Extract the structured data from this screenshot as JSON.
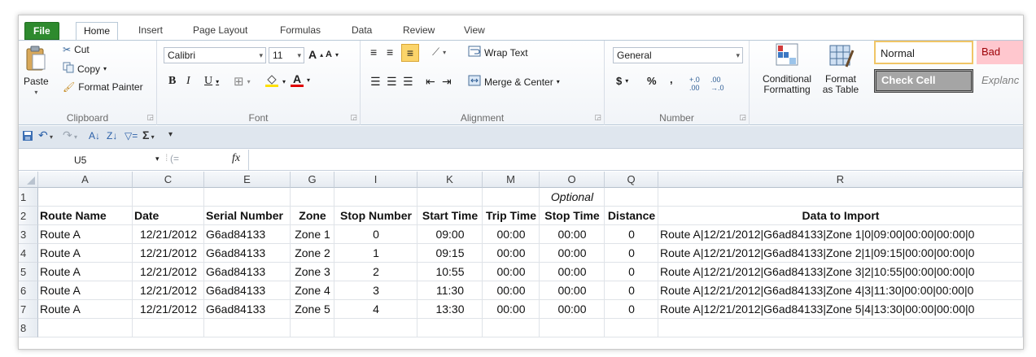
{
  "ribbon": {
    "tabs": [
      "File",
      "Home",
      "Insert",
      "Page Layout",
      "Formulas",
      "Data",
      "Review",
      "View"
    ],
    "clipboard": {
      "paste": "Paste",
      "cut": "Cut",
      "copy": "Copy",
      "format_painter": "Format Painter",
      "label": "Clipboard"
    },
    "font": {
      "name": "Calibri",
      "size": "11",
      "bold": "B",
      "italic": "I",
      "underline": "U",
      "grow": "A",
      "shrink": "A",
      "color_a": "A",
      "label": "Font"
    },
    "alignment": {
      "wrap_text": "Wrap Text",
      "merge_center": "Merge & Center",
      "label": "Alignment"
    },
    "number": {
      "format": "General",
      "currency": "$",
      "percent": "%",
      "comma": ",",
      "inc_dec": ".0 .00",
      "label": "Number"
    },
    "styles": {
      "conditional": "Conditional Formatting",
      "format_table": "Format as Table",
      "normal": "Normal",
      "bad": "Bad",
      "check_cell": "Check Cell",
      "explanatory": "Explanc"
    }
  },
  "formula_bar": {
    "name_box": "U5",
    "fx": "fx",
    "value": ""
  },
  "columns": [
    "A",
    "C",
    "E",
    "G",
    "I",
    "K",
    "M",
    "O",
    "Q",
    "R"
  ],
  "rows": [
    "1",
    "2",
    "3",
    "4",
    "5",
    "6",
    "7",
    "8"
  ],
  "sheet": {
    "optional": "Optional",
    "headers": [
      "Route Name",
      "Date",
      "Serial Number",
      "Zone",
      "Stop Number",
      "Start Time",
      "Trip Time",
      "Stop Time",
      "Distance",
      "Data to Import"
    ],
    "data": [
      [
        "Route A",
        "12/21/2012",
        "G6ad84133",
        "Zone 1",
        "0",
        "09:00",
        "00:00",
        "00:00",
        "0",
        "Route A|12/21/2012|G6ad84133|Zone 1|0|09:00|00:00|00:00|0"
      ],
      [
        "Route A",
        "12/21/2012",
        "G6ad84133",
        "Zone 2",
        "1",
        "09:15",
        "00:00",
        "00:00",
        "0",
        "Route A|12/21/2012|G6ad84133|Zone 2|1|09:15|00:00|00:00|0"
      ],
      [
        "Route A",
        "12/21/2012",
        "G6ad84133",
        "Zone 3",
        "2",
        "10:55",
        "00:00",
        "00:00",
        "0",
        "Route A|12/21/2012|G6ad84133|Zone 3|2|10:55|00:00|00:00|0"
      ],
      [
        "Route A",
        "12/21/2012",
        "G6ad84133",
        "Zone 4",
        "3",
        "11:30",
        "00:00",
        "00:00",
        "0",
        "Route A|12/21/2012|G6ad84133|Zone 4|3|11:30|00:00|00:00|0"
      ],
      [
        "Route A",
        "12/21/2012",
        "G6ad84133",
        "Zone 5",
        "4",
        "13:30",
        "00:00",
        "00:00",
        "0",
        "Route A|12/21/2012|G6ad84133|Zone 5|4|13:30|00:00|00:00|0"
      ]
    ]
  },
  "colors": {
    "file_tab": "#2e8a2e",
    "bad_bg": "#ffc7ce",
    "bad_text": "#9c0006",
    "check_cell": "#a5a5a5",
    "normal_border": "#f0c566"
  }
}
